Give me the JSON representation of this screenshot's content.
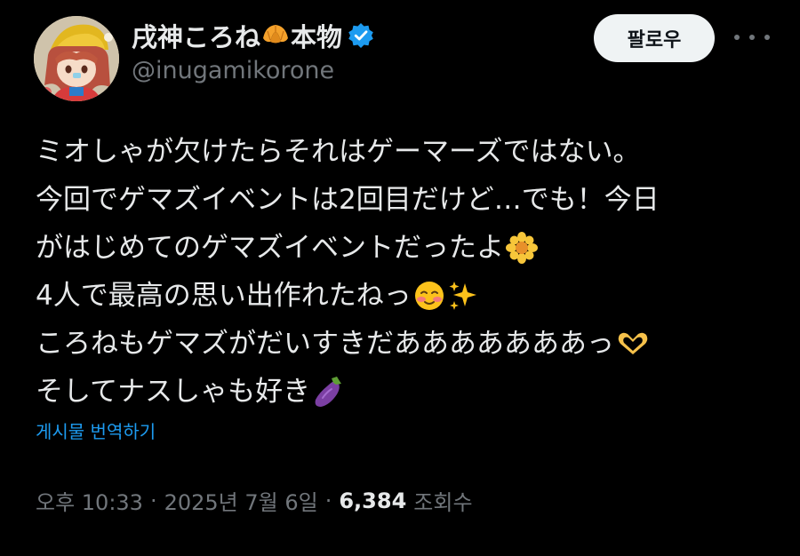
{
  "user": {
    "display_name": "戌神ころね",
    "display_name_suffix": "本物",
    "handle": "@inugamikorone",
    "name_emoji": "croissant-icon",
    "verified": true
  },
  "actions": {
    "follow_label": "팔로우",
    "more_icon": "more-horizontal-icon"
  },
  "tweet": {
    "lines": [
      "ミオしゃが欠けたらそれはゲーマーズではない。",
      "今回でゲマズイベントは2回目だけど…でも！今日",
      "がはじめてのゲマズイベントだったよ",
      "4人で最高の思い出作れたねっ",
      "ころねもゲマズがだいすきだあああああああっ",
      "そしてナスしゃも好き"
    ],
    "line_emojis": [
      "",
      "",
      "blossom-icon",
      "smiling-face-sparkles-icon",
      "heart-hands-icon",
      "eggplant-icon"
    ],
    "translate_label": "게시물 번역하기"
  },
  "meta": {
    "time": "오후 10:33",
    "separator": "·",
    "date": "2025년 7월 6일",
    "views_count": "6,384",
    "views_label": "조회수"
  },
  "colors": {
    "background": "#000000",
    "text": "#e7e9ea",
    "muted": "#71767b",
    "link": "#1d9bf0",
    "verified": "#1d9bf0",
    "button_bg": "#eff3f4"
  }
}
